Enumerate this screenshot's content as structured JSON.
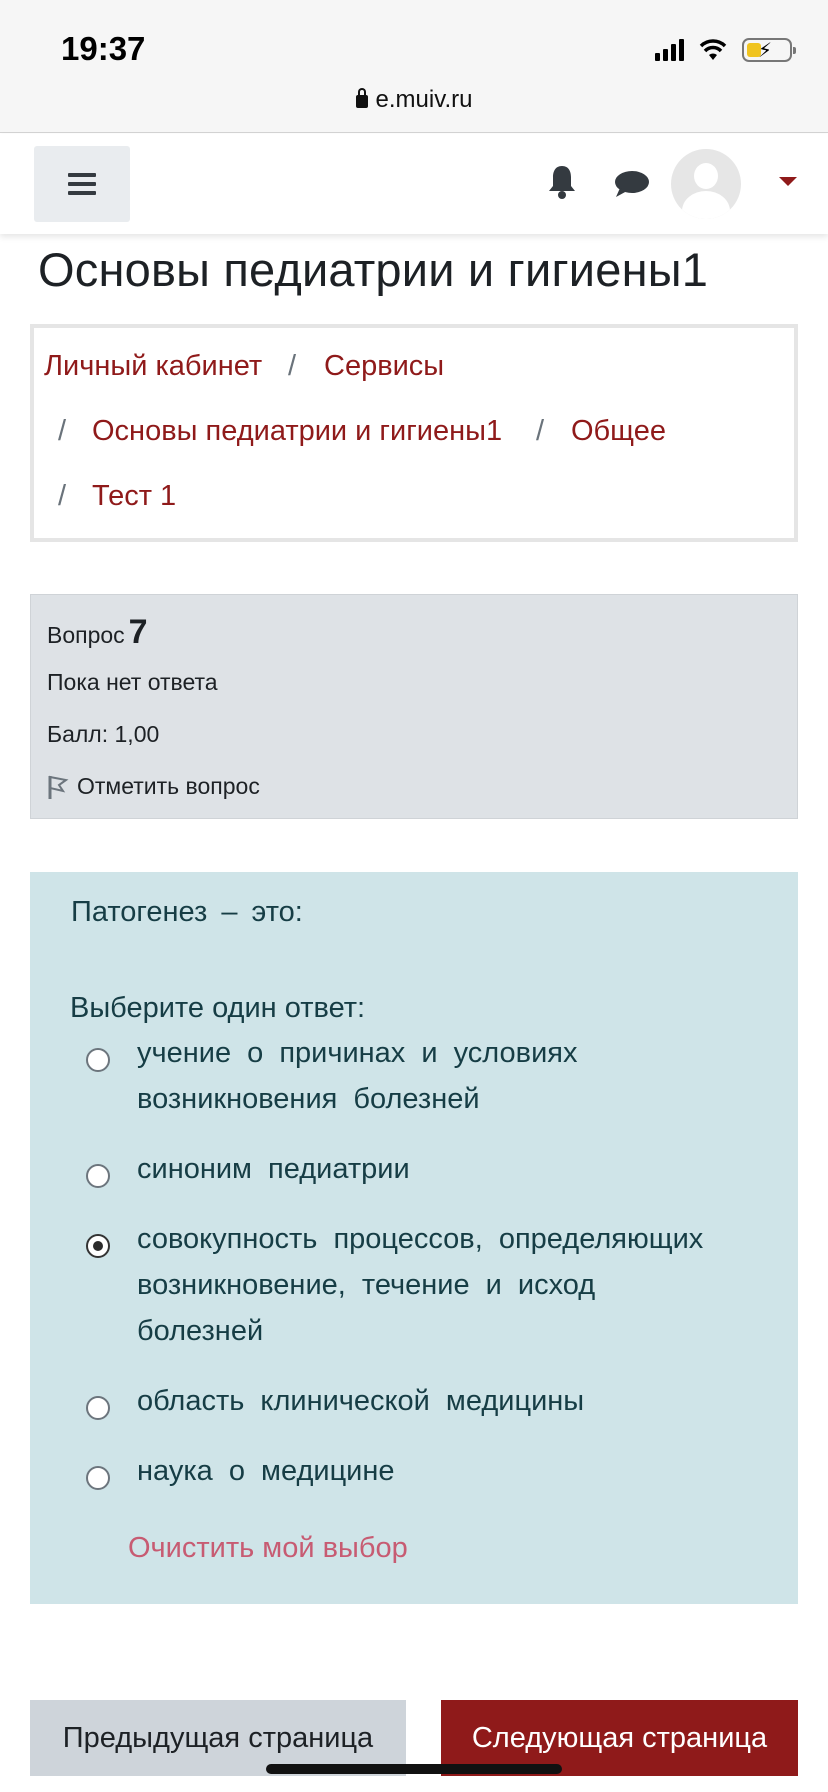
{
  "status_bar": {
    "time": "19:37",
    "url": "e.muiv.ru"
  },
  "navbar": {
    "menu_icon": "hamburger-icon",
    "notifications_icon": "bell-icon",
    "messages_icon": "chat-bubble-icon",
    "user_menu_icon": "caret-down-icon"
  },
  "page": {
    "title": "Основы педиатрии и гигиены1"
  },
  "breadcrumb": [
    {
      "label": "Личный кабинет"
    },
    {
      "label": "Сервисы"
    },
    {
      "label": "Основы педиатрии и гигиены1"
    },
    {
      "label": "Общее"
    },
    {
      "label": "Тест 1"
    }
  ],
  "question_info": {
    "number_label": "Вопрос",
    "number": "7",
    "state": "Пока нет ответа",
    "grade": "Балл: 1,00",
    "flag_label": "Отметить вопрос"
  },
  "question": {
    "text": "Патогенез – это:",
    "prompt": "Выберите один ответ:",
    "options": [
      {
        "line1": "учение о причинах и условиях",
        "line2": "возникновения болезней",
        "line3": "",
        "selected": false
      },
      {
        "line1": "синоним педиатрии",
        "line2": "",
        "line3": "",
        "selected": false
      },
      {
        "line1": "совокупность процессов, определяющих",
        "line2": "возникновение, течение и исход",
        "line3": "болезней",
        "selected": true
      },
      {
        "line1": "область клинической медицины",
        "line2": "",
        "line3": "",
        "selected": false
      },
      {
        "line1": "наука о медицине",
        "line2": "",
        "line3": "",
        "selected": false
      }
    ],
    "clear_label": "Очистить мой выбор"
  },
  "navigation": {
    "prev_label": "Предыдущая страница",
    "next_label": "Следующая страница"
  },
  "colors": {
    "brand": "#8f1a1a",
    "question_bg": "#cfe4e8",
    "info_bg": "#dee2e6",
    "clear_link": "#c75b72"
  }
}
